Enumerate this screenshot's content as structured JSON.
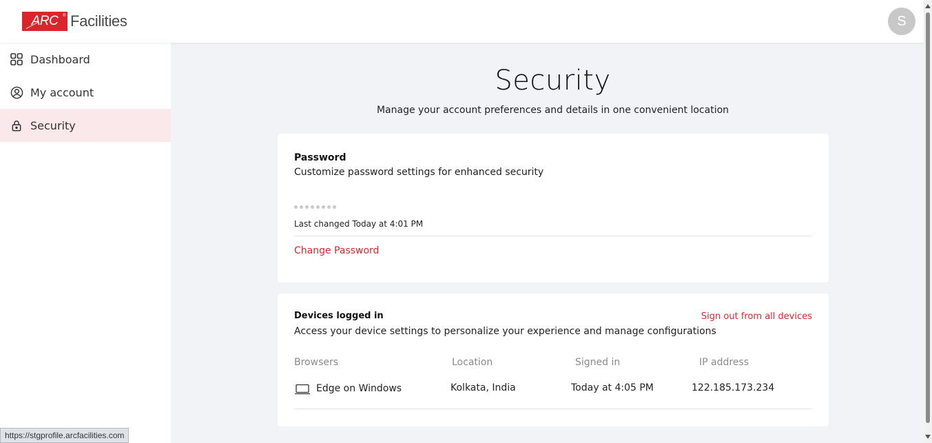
{
  "header": {
    "logo_mark": "ARC",
    "logo_text": "Facilities",
    "avatar_initial": "S"
  },
  "sidebar": {
    "items": [
      {
        "label": "Dashboard",
        "icon": "grid-icon",
        "active": false
      },
      {
        "label": "My account",
        "icon": "user-circle-icon",
        "active": false
      },
      {
        "label": "Security",
        "icon": "lock-icon",
        "active": true
      }
    ]
  },
  "page": {
    "title": "Security",
    "subtitle": "Manage your account preferences and details in one convenient location"
  },
  "password_card": {
    "title": "Password",
    "description": "Customize password settings for enhanced security",
    "masked_length": 8,
    "last_changed": "Last changed Today at 4:01 PM",
    "change_link": "Change Password"
  },
  "devices_card": {
    "title": "Devices logged in",
    "description": "Access your device settings to personalize your experience and manage configurations",
    "sign_out_all": "Sign out from all devices",
    "columns": [
      "Browsers",
      "Location",
      "Signed in",
      "IP address"
    ],
    "rows": [
      {
        "browser": "Edge on Windows",
        "location": "Kolkata, India",
        "signed_in": "Today at 4:05 PM",
        "ip": "122.185.173.234",
        "icon": "laptop-icon"
      }
    ]
  },
  "status_bar": {
    "url": "https://stgprofile.arcfacilities.com"
  },
  "colors": {
    "accent": "#e3242b",
    "active_bg": "#fbe8ea",
    "page_bg": "#f1f3f6"
  }
}
